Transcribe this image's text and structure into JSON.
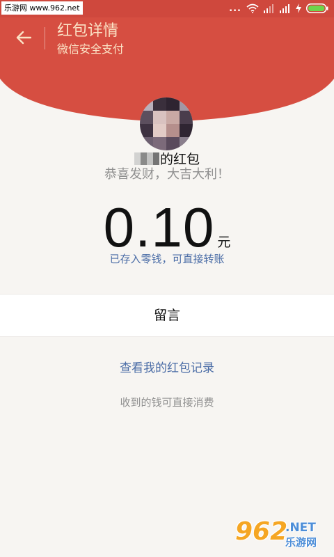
{
  "status_bar": {
    "watermark_text": "乐游网 www.962.net",
    "dots": "...",
    "colors": {
      "background": "#cf483d"
    },
    "icons": [
      "wifi-icon",
      "signal-icon",
      "signal-icon",
      "charging-icon",
      "battery-icon"
    ]
  },
  "header": {
    "title": "红包详情",
    "subtitle": "微信安全支付",
    "back_icon": "arrow-left-icon",
    "colors": {
      "background": "#d64e41",
      "text": "#fbe3c6"
    }
  },
  "packet": {
    "sender_suffix": "的红包",
    "greeting": "恭喜发财，大吉大利！",
    "amount": "0.10",
    "unit": "元",
    "saved_note": "已存入零钱，可直接转账"
  },
  "message": {
    "label": "留言"
  },
  "records": {
    "link": "查看我的红包记录",
    "note": "收到的钱可直接消费"
  },
  "watermark": {
    "number": "962",
    "net": ".NET",
    "site": "乐游网"
  },
  "colors": {
    "link": "#4a6ca6",
    "muted_text": "#8f8f8f",
    "page_background": "#f7f5f2"
  }
}
